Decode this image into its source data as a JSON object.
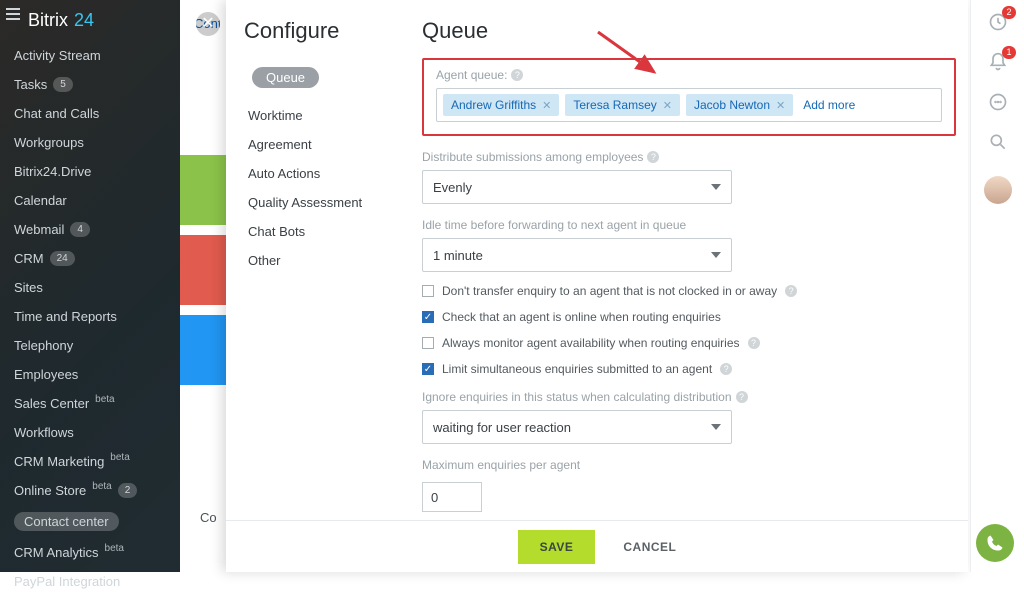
{
  "logo": {
    "part1": "Bitrix",
    "part2": "24"
  },
  "sidebar": [
    {
      "label": "Activity Stream"
    },
    {
      "label": "Tasks",
      "badge": "5"
    },
    {
      "label": "Chat and Calls"
    },
    {
      "label": "Workgroups"
    },
    {
      "label": "Bitrix24.Drive"
    },
    {
      "label": "Calendar"
    },
    {
      "label": "Webmail",
      "badge": "4"
    },
    {
      "label": "CRM",
      "badge": "24"
    },
    {
      "label": "Sites"
    },
    {
      "label": "Time and Reports"
    },
    {
      "label": "Telephony"
    },
    {
      "label": "Employees"
    },
    {
      "label": "Sales Center",
      "beta": "beta"
    },
    {
      "label": "Workflows"
    },
    {
      "label": "CRM Marketing",
      "beta": "beta"
    },
    {
      "label": "Online Store",
      "beta": "beta",
      "badge": "2"
    },
    {
      "label": "Contact center",
      "active": true
    },
    {
      "label": "CRM Analytics",
      "beta": "beta"
    },
    {
      "label": "PayPal Integration"
    }
  ],
  "bgTab": "Cont",
  "bgHead": "Cont",
  "bgCont": "Co",
  "configure": {
    "title": "Configure",
    "menu": [
      "Queue",
      "Worktime",
      "Agreement",
      "Auto Actions",
      "Quality Assessment",
      "Chat Bots",
      "Other"
    ],
    "selected": 0
  },
  "queue": {
    "title": "Queue",
    "agentLabel": "Agent queue:",
    "agents": [
      "Andrew Griffiths",
      "Teresa Ramsey",
      "Jacob Newton"
    ],
    "addMore": "Add more",
    "distributeLabel": "Distribute submissions among employees",
    "distributeValue": "Evenly",
    "idleLabel": "Idle time before forwarding to next agent in queue",
    "idleValue": "1 minute",
    "checks": [
      {
        "on": false,
        "text": "Don't transfer enquiry to an agent that is not clocked in or away",
        "help": true
      },
      {
        "on": true,
        "text": "Check that an agent is online when routing enquiries"
      },
      {
        "on": false,
        "text": "Always monitor agent availability when routing enquiries",
        "help": true
      },
      {
        "on": true,
        "text": "Limit simultaneous enquiries submitted to an agent",
        "help": true
      }
    ],
    "ignoreLabel": "Ignore enquiries in this status when calculating distribution",
    "ignoreValue": "waiting for user reaction",
    "maxLabel": "Maximum enquiries per agent",
    "maxValue": "0"
  },
  "footer": {
    "save": "SAVE",
    "cancel": "CANCEL"
  },
  "rail": {
    "badge1": "2",
    "badge2": "1"
  }
}
